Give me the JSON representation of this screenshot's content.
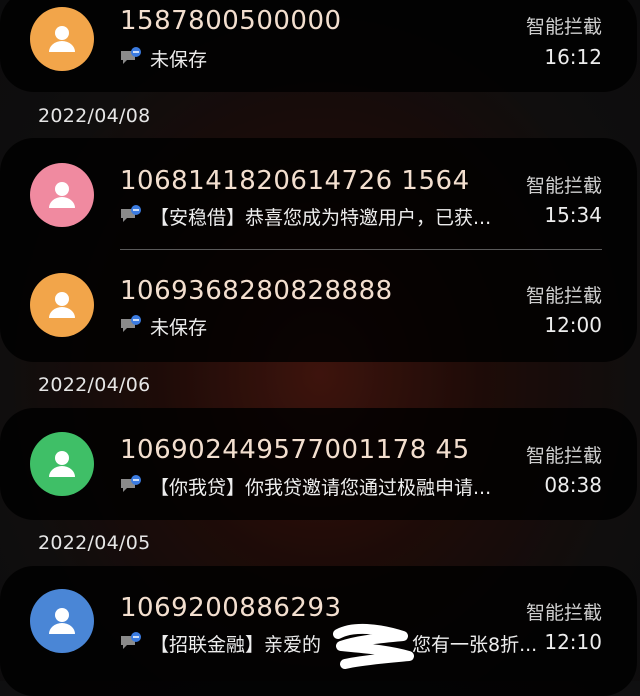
{
  "colors": {
    "avatar_orange": "#f2a54a",
    "avatar_pink": "#f08aa0",
    "avatar_green": "#3fbf67",
    "avatar_blue": "#4a86d6",
    "sender_text": "#f3dfcf"
  },
  "groups": [
    {
      "date": "",
      "items": [
        {
          "avatar_color": "#f2a54a",
          "icon": "person-icon",
          "sender": "1587800500000",
          "label": "智能拦截",
          "preview": "未保存",
          "time": "16:12"
        }
      ]
    },
    {
      "date": "2022/04/08",
      "items": [
        {
          "avatar_color": "#f08aa0",
          "icon": "person-icon",
          "sender": "1068141820614726 1564",
          "label": "智能拦截",
          "preview": "【安稳借】恭喜您成为特邀用户，已获...",
          "time": "15:34"
        },
        {
          "avatar_color": "#f2a54a",
          "icon": "person-icon",
          "sender": "1069368280828888",
          "label": "智能拦截",
          "preview": "未保存",
          "time": "12:00"
        }
      ]
    },
    {
      "date": "2022/04/06",
      "items": [
        {
          "avatar_color": "#3fbf67",
          "icon": "person-icon",
          "sender": "106902449577001178 45",
          "label": "智能拦截",
          "preview": "【你我贷】你我贷邀请您通过极融申请...",
          "time": "08:38"
        }
      ]
    },
    {
      "date": "2022/04/05",
      "items": [
        {
          "avatar_color": "#4a86d6",
          "icon": "person-icon",
          "sender": "1069200886293",
          "label": "智能拦截",
          "preview": "【招联金融】亲爱的",
          "preview_tail": "您有一张8折...",
          "time": "12:10"
        }
      ]
    }
  ]
}
